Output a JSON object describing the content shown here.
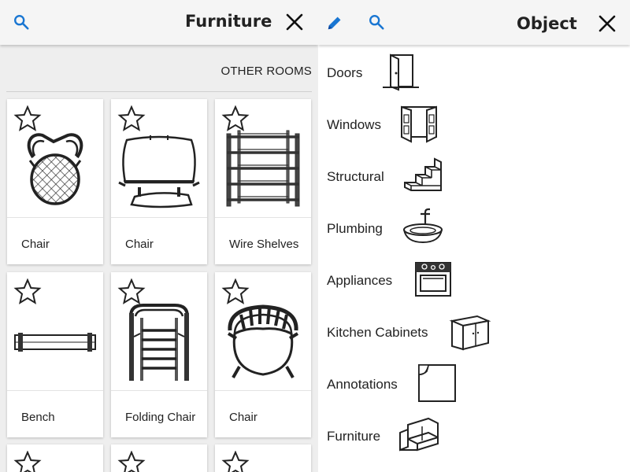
{
  "furniture_panel": {
    "title": "Furniture",
    "other_rooms_label": "OTHER ROOMS",
    "items": [
      {
        "label": "Chair",
        "icon": "round-chair-icon"
      },
      {
        "label": "Chair",
        "icon": "armchair-icon"
      },
      {
        "label": "Wire Shelves",
        "icon": "wire-shelves-icon"
      },
      {
        "label": "Bench",
        "icon": "bench-icon"
      },
      {
        "label": "Folding Chair",
        "icon": "folding-chair-icon"
      },
      {
        "label": "Chair",
        "icon": "spindle-chair-icon"
      }
    ]
  },
  "object_panel": {
    "title": "Object",
    "categories": [
      {
        "label": "Doors",
        "icon": "door-icon"
      },
      {
        "label": "Windows",
        "icon": "window-icon"
      },
      {
        "label": "Structural",
        "icon": "stairs-icon"
      },
      {
        "label": "Plumbing",
        "icon": "sink-icon"
      },
      {
        "label": "Appliances",
        "icon": "stove-icon"
      },
      {
        "label": "Kitchen Cabinets",
        "icon": "cabinet-icon"
      },
      {
        "label": "Annotations",
        "icon": "sticky-note-icon"
      },
      {
        "label": "Furniture",
        "icon": "sofa-icon"
      }
    ]
  },
  "colors": {
    "accent": "#1976d2",
    "panel_bg": "#eeeeee",
    "card_bg": "#ffffff",
    "text": "#222222"
  }
}
